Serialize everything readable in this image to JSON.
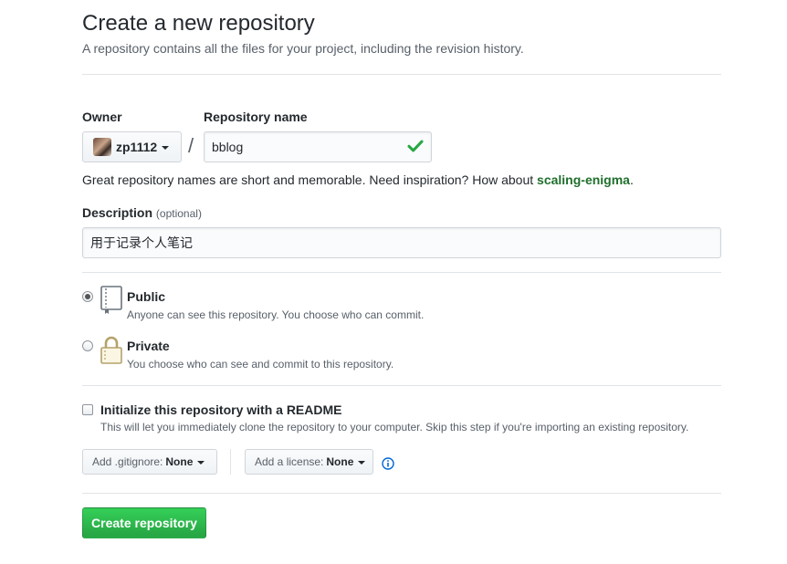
{
  "header": {
    "title": "Create a new repository",
    "subtitle": "A repository contains all the files for your project, including the revision history."
  },
  "owner": {
    "label": "Owner",
    "value": "zp1112"
  },
  "separator": "/",
  "repo": {
    "label": "Repository name",
    "value": "bblog",
    "valid": true,
    "hint_prefix": "Great repository names are short and memorable. Need inspiration? How about ",
    "suggestion": "scaling-enigma",
    "hint_suffix": "."
  },
  "description": {
    "label": "Description",
    "optional": "(optional)",
    "value": "用于记录个人笔记"
  },
  "visibility": {
    "options": [
      {
        "title": "Public",
        "desc": "Anyone can see this repository. You choose who can commit.",
        "selected": true,
        "icon": "repo-book-icon"
      },
      {
        "title": "Private",
        "desc": "You choose who can see and commit to this repository.",
        "selected": false,
        "icon": "lock-icon"
      }
    ]
  },
  "readme": {
    "title": "Initialize this repository with a README",
    "desc": "This will let you immediately clone the repository to your computer. Skip this step if you're importing an existing repository.",
    "checked": false
  },
  "gitignore": {
    "label": "Add .gitignore:",
    "value": "None"
  },
  "license": {
    "label": "Add a license:",
    "value": "None"
  },
  "submit": {
    "label": "Create repository"
  },
  "colors": {
    "accent_green": "#28a745",
    "suggestion_green": "#1f6f2c",
    "info_blue": "#0366d6",
    "icon_gold": "#b5a26a"
  }
}
